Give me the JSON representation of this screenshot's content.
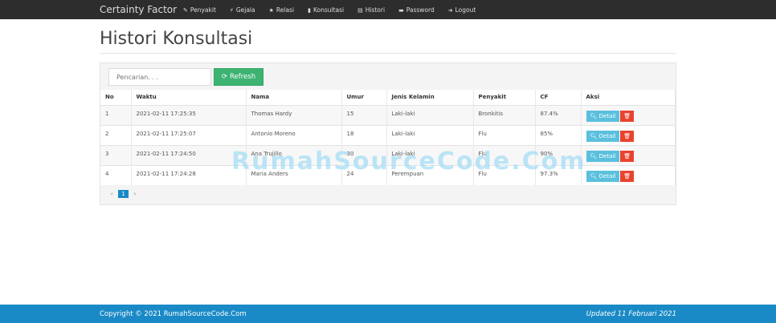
{
  "navbar": {
    "brand": "Certainty Factor",
    "items": [
      {
        "label": "Penyakit",
        "icon": "pushpin-icon",
        "glyph": "✎"
      },
      {
        "label": "Gejala",
        "icon": "flash-icon",
        "glyph": "⚡"
      },
      {
        "label": "Relasi",
        "icon": "star-icon",
        "glyph": "★"
      },
      {
        "label": "Konsultasi",
        "icon": "stats-icon",
        "glyph": "▮"
      },
      {
        "label": "Histori",
        "icon": "calendar-icon",
        "glyph": "▤"
      },
      {
        "label": "Password",
        "icon": "lock-icon",
        "glyph": "▬"
      },
      {
        "label": "Logout",
        "icon": "logout-icon",
        "glyph": "➜"
      }
    ]
  },
  "page_title": "Histori Konsultasi",
  "search": {
    "placeholder": "Pencarian. . ."
  },
  "refresh_label": "Refresh",
  "table": {
    "headers": [
      "No",
      "Waktu",
      "Nama",
      "Umur",
      "Jenis Kelamin",
      "Penyakit",
      "CF",
      "Aksi"
    ],
    "rows": [
      [
        "1",
        "2021-02-11 17:25:35",
        "Thomas Hardy",
        "15",
        "Laki-laki",
        "Bronkitis",
        "87.4%"
      ],
      [
        "2",
        "2021-02-11 17:25:07",
        "Antonio Moreno",
        "18",
        "Laki-laki",
        "Flu",
        "85%"
      ],
      [
        "3",
        "2021-02-11 17:24:50",
        "Ana Trujillo",
        "30",
        "Laki-laki",
        "Flu",
        "90%"
      ],
      [
        "4",
        "2021-02-11 17:24:28",
        "Maria Anders",
        "24",
        "Perempuan",
        "Flu",
        "97.3%"
      ]
    ],
    "detail_label": "Detail"
  },
  "pagination": {
    "prev": "«",
    "current": "1",
    "next": "»"
  },
  "watermark": "RumahSourceCode.Com",
  "footer": {
    "copyright": "Copyright © 2021 RumahSourceCode.Com",
    "updated": "Updated 11 Februari 2021"
  },
  "colors": {
    "navbar": "#2d2d2d",
    "footer": "#1a8ac6",
    "refresh": "#3cb371",
    "detail": "#5bc0de",
    "delete": "#e8432f"
  }
}
